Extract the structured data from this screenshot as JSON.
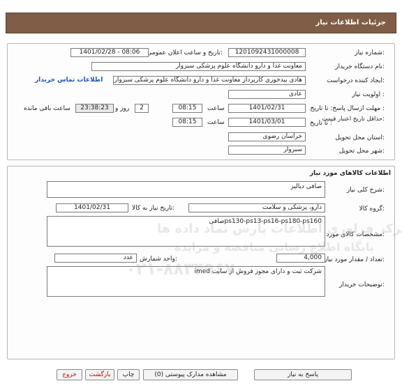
{
  "header": {
    "title": "جزئیات اطلاعات نیاز"
  },
  "need_info": {
    "need_number_label": "شماره نیاز:",
    "need_number": "1201092431000008",
    "announce_label": "تاریخ و ساعت اعلان عمومی:",
    "announce_value": "1401/02/28 - 08:06",
    "buyer_org_label": "نام دستگاه خریدار:",
    "buyer_org": "معاونت غذا و دارو   دانشگاه علوم پزشکی سبزوار",
    "requester_label": "ایجاد کننده درخواست:",
    "requester": "هادی بیدخوری کارپرداز معاونت غذا و دارو   دانشگاه علوم پزشکی سبزوار",
    "contact_link": "اطلاعات تماس خریدار",
    "priority_label": "اولویت نیاز :",
    "priority": "عادی",
    "deadline_label": "مهلت ارسال پاسخ: تا تاریخ :",
    "deadline_date": "1401/02/31",
    "time_label": "ساعت",
    "deadline_time": "08:15",
    "days_value": "2",
    "days_label": "روز و",
    "remaining_time": "23:38:23",
    "remaining_label": "ساعت باقی مانده",
    "min_price_label": "حداقل تاریخ اعتبار قیمت:",
    "min_price_sub": "تا تاریخ :",
    "min_price_date": "1401/03/01",
    "min_price_time": "08:15",
    "province_label": "استان محل تحویل:",
    "province": "خراسان رضوی",
    "city_label": "شهر محل تحویل:",
    "city": "سبزوار"
  },
  "goods": {
    "section_title": "اطلاعات کالاهای مورد نیاز",
    "summary_label": "شرح کلی نیاز:",
    "summary": "صافی دیالیز",
    "group_label": "گروه کالا:",
    "group": "دارو، پزشکی و سلامت",
    "need_date_label": "تاریخ نیاز به کالا:",
    "need_date": "1401/02/31",
    "specs_label": "مشخصات کالای مورد نیاز:",
    "specs": "صافیps130-ps13-ps16-ps180-ps160",
    "quantity_label": "تعداد / مقدار مورد نیاز:",
    "quantity": "4,000",
    "unit_label": "واحد شمارش:",
    "unit": "عدد",
    "buyer_notes_label": "توضیحات خریدار:",
    "buyer_notes": "شرکت ثبت و دارای مجوز فروش از سایت imed"
  },
  "actions": {
    "reply": "پاسخ به نیاز",
    "attachments": "مشاهده مدارک پیوستی (0)",
    "print": "چاپ",
    "back": "بازگشت",
    "exit": "خروج"
  },
  "watermark": {
    "line1": "مرکز فراوری اطلاعات پارس نماد داده ها",
    "line2": "پایگاه اطلاع رسانی مناقصه و مزایده",
    "phone": "۰۲۱-۸۸۳۴۹۶۷۰"
  }
}
